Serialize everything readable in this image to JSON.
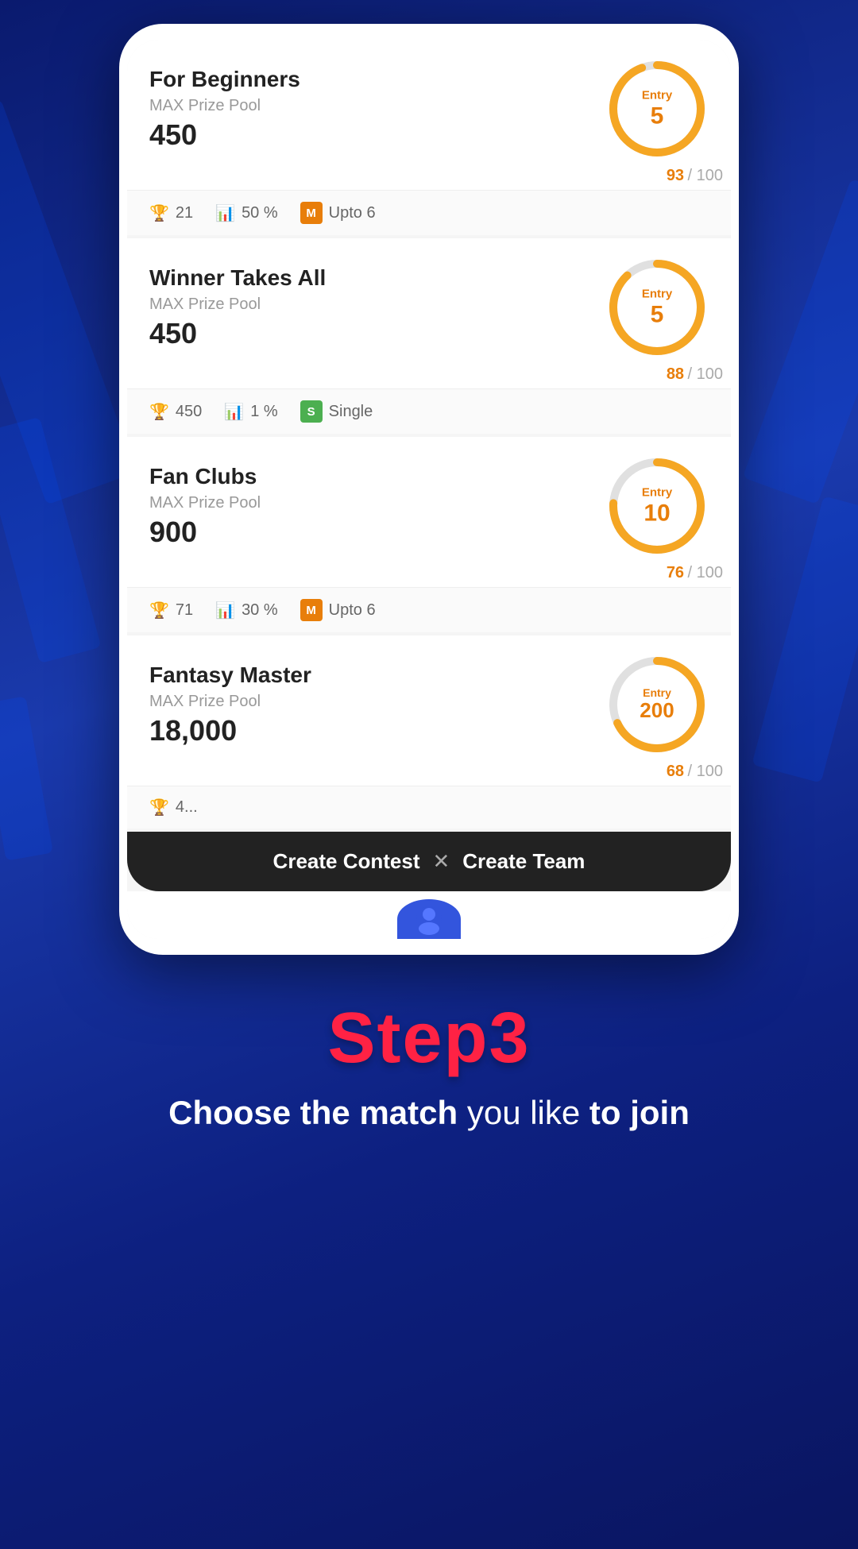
{
  "background": {
    "stripes": 5
  },
  "phone": {
    "contests": [
      {
        "id": "beginners",
        "title": "For Beginners",
        "pool_label": "MAX Prize Pool",
        "pool_value": "450",
        "entry": "5",
        "filled": 93,
        "total": 100,
        "stats": [
          {
            "icon": "trophy",
            "value": "21"
          },
          {
            "icon": "chart",
            "value": "50 %"
          },
          {
            "badge": "M",
            "value": "Upto 6"
          }
        ],
        "arc_color": "#f5a623",
        "arc_percent": 93
      },
      {
        "id": "winner-takes-all",
        "title": "Winner Takes All",
        "pool_label": "MAX Prize Pool",
        "pool_value": "450",
        "entry": "5",
        "filled": 88,
        "total": 100,
        "stats": [
          {
            "icon": "trophy",
            "value": "450"
          },
          {
            "icon": "chart",
            "value": "1 %"
          },
          {
            "badge": "S",
            "value": "Single"
          }
        ],
        "arc_color": "#f5a623",
        "arc_percent": 88
      },
      {
        "id": "fan-clubs",
        "title": "Fan Clubs",
        "pool_label": "MAX Prize Pool",
        "pool_value": "900",
        "entry": "10",
        "filled": 76,
        "total": 100,
        "stats": [
          {
            "icon": "trophy",
            "value": "71"
          },
          {
            "icon": "chart",
            "value": "30 %"
          },
          {
            "badge": "M",
            "value": "Upto 6"
          }
        ],
        "arc_color": "#f5a623",
        "arc_percent": 76
      },
      {
        "id": "fantasy-master",
        "title": "Fantasy Master",
        "pool_label": "MAX Prize Pool",
        "pool_value": "18,000",
        "entry": "200",
        "filled": 68,
        "total": 100,
        "stats": [
          {
            "icon": "trophy",
            "value": "4..."
          }
        ],
        "arc_color": "#f5a623",
        "arc_percent": 68
      }
    ],
    "action_bar": {
      "create_contest": "Create Contest",
      "divider": "✕",
      "create_team": "Create Team"
    }
  },
  "step": {
    "title": "Step3",
    "subtitle_bold": "Choose the match",
    "subtitle_normal": " you like ",
    "subtitle_bold2": "to join"
  }
}
